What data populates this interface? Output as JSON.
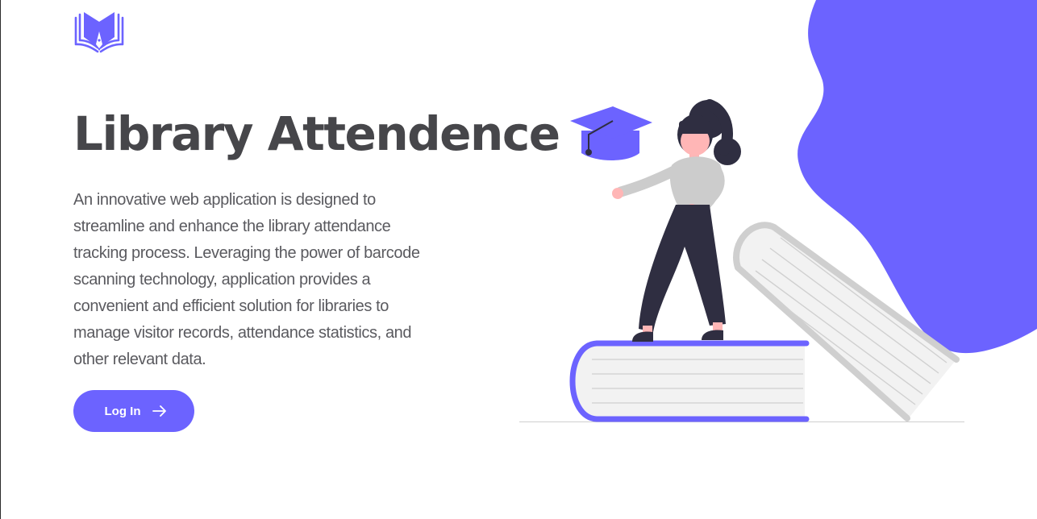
{
  "header": {
    "logo_icon": "open-book-pen-icon"
  },
  "hero": {
    "title": "Library Attendence",
    "description": "An innovative web application is designed to streamline and enhance the library attendance tracking process. Leveraging the power of barcode scanning technology, application provides a convenient and efficient solution for libraries to manage visitor records, attendance statistics, and other relevant data.",
    "login_label": "Log In",
    "login_icon": "arrow-right-icon"
  },
  "illustration": {
    "subject": "woman-standing-on-books-illustration",
    "accent_color": "#6c63ff",
    "figure_color": "#2f2e41",
    "book_color": "#f2f2f2"
  },
  "colors": {
    "accent": "#6c63ff",
    "text": "#46464a"
  }
}
